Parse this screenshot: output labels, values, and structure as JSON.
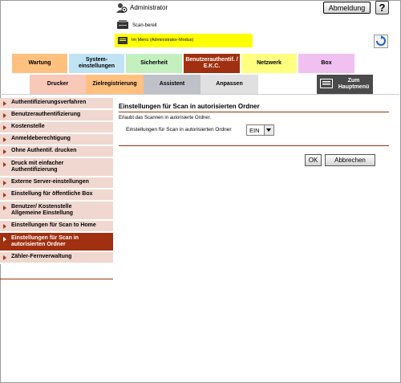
{
  "header": {
    "user_label": "Administrator",
    "logout_label": "Abmeldung",
    "help_label": "?",
    "scan_status": "Scan-bereit",
    "mode_status": "Im Menü (Administrator-Modus)"
  },
  "tabs": [
    {
      "label": "Wartung"
    },
    {
      "label": "System-\neinstellungen"
    },
    {
      "label": "Sicherheit"
    },
    {
      "label": "Benutzerauthentif. /\nE.K.C."
    },
    {
      "label": "Netzwerk"
    },
    {
      "label": "Box"
    }
  ],
  "subtabs": [
    {
      "label": "Drucker"
    },
    {
      "label": "Zielregistrierung"
    },
    {
      "label": "Assistent"
    },
    {
      "label": "Anpassen"
    }
  ],
  "home": {
    "label": "Zum\nHauptmenü"
  },
  "sidebar": {
    "items": [
      {
        "label": "Authentifizierungsverfahren"
      },
      {
        "label": "Benutzerauthentifizierung"
      },
      {
        "label": "Kostenstelle"
      },
      {
        "label": "Anmeldeberechtigung"
      },
      {
        "label": "Ohne Authentif. drucken"
      },
      {
        "label": "Druck mit einfacher\nAuthentifizierung"
      },
      {
        "label": "Externe Server-einstellungen"
      },
      {
        "label": "Einstellung für öffentliche Box"
      },
      {
        "label": "Benutzer/ Kostenstelle\nAllgemeine Einstellung"
      },
      {
        "label": "Einstellungen für Scan to Home"
      },
      {
        "label": "Einstellungen für Scan in\nautorisierten Ordner"
      },
      {
        "label": "Zähler-Fernverwaltung"
      }
    ],
    "active_index": 10
  },
  "main": {
    "title": "Einstellungen für Scan in autorisierten Ordner",
    "description": "Erlaubt das Scannen in autorisierte Ordner.",
    "setting_label": "Einstellungen für Scan in autorisierten Ordner",
    "setting_value": "EIN",
    "ok_label": "OK",
    "cancel_label": "Abbrechen"
  },
  "colors": {
    "accent": "#a03010",
    "sidebar_bg": "#f0d8d0",
    "mode_bar": "#ffff00"
  }
}
